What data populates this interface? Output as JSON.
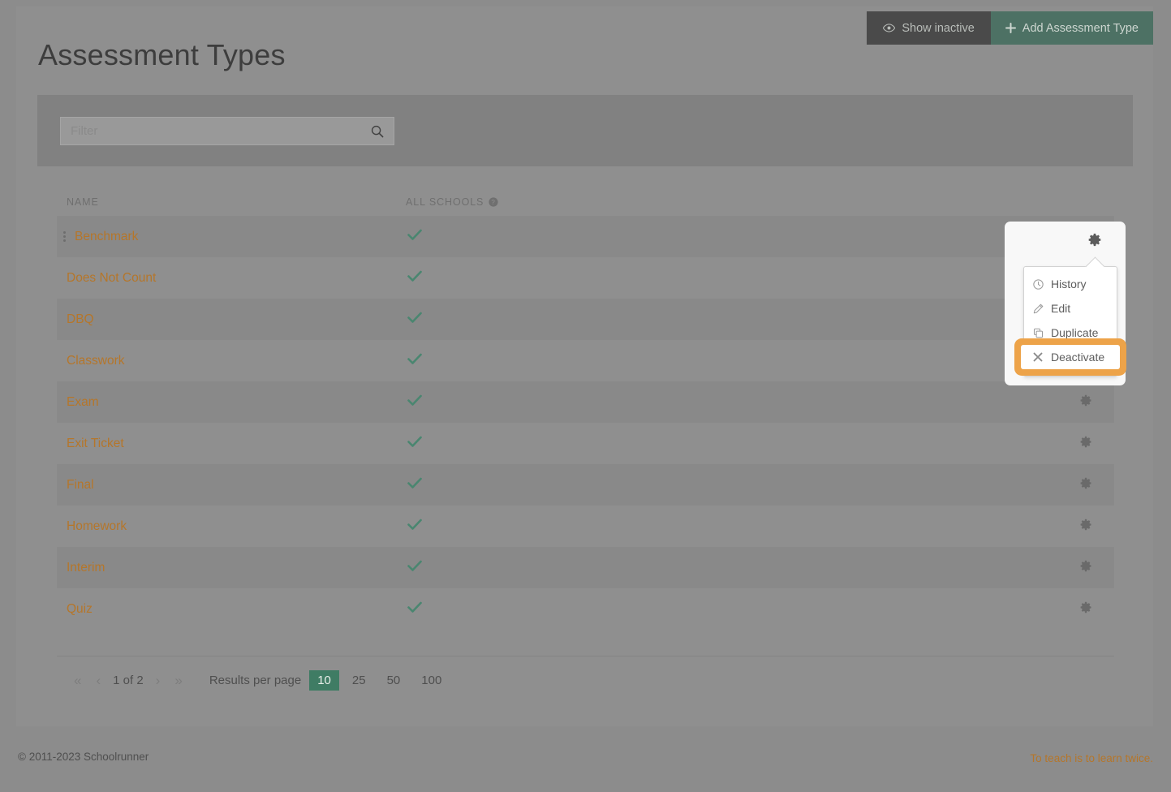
{
  "header": {
    "title": "Assessment Types",
    "actions": [
      {
        "label": "Show inactive",
        "icon": "eye-icon"
      },
      {
        "label": "Add Assessment Type",
        "icon": "plus-icon"
      }
    ]
  },
  "filter": {
    "placeholder": "Filter",
    "value": "",
    "search_icon": "search-icon"
  },
  "table": {
    "columns": [
      {
        "key": "name",
        "label": "NAME"
      },
      {
        "key": "all_schools",
        "label": "ALL SCHOOLS",
        "help_icon": "question-circle-icon"
      }
    ],
    "rows": [
      {
        "name": "Benchmark",
        "all_schools": true,
        "has_drag_handle": true,
        "gear": "gear-icon"
      },
      {
        "name": "Does Not Count",
        "all_schools": true,
        "has_drag_handle": false,
        "gear": "gear-icon"
      },
      {
        "name": "DBQ",
        "all_schools": true,
        "has_drag_handle": false,
        "gear": "gear-icon"
      },
      {
        "name": "Classwork",
        "all_schools": true,
        "has_drag_handle": false,
        "gear": "gear-icon"
      },
      {
        "name": "Exam",
        "all_schools": true,
        "has_drag_handle": false,
        "gear": "gear-icon"
      },
      {
        "name": "Exit Ticket",
        "all_schools": true,
        "has_drag_handle": false,
        "gear": "gear-icon"
      },
      {
        "name": "Final",
        "all_schools": true,
        "has_drag_handle": false,
        "gear": "gear-icon"
      },
      {
        "name": "Homework",
        "all_schools": true,
        "has_drag_handle": false,
        "gear": "gear-icon"
      },
      {
        "name": "Interim",
        "all_schools": true,
        "has_drag_handle": false,
        "gear": "gear-icon"
      },
      {
        "name": "Quiz",
        "all_schools": true,
        "has_drag_handle": false,
        "gear": "gear-icon"
      }
    ]
  },
  "pagination": {
    "first_icon": "«",
    "prev_icon": "‹",
    "page_label": "1 of 2",
    "next_icon": "›",
    "last_icon": "»",
    "results_per_page_label": "Results per page",
    "options": [
      "10",
      "25",
      "50",
      "100"
    ],
    "selected": "10"
  },
  "context_menu": {
    "trigger_icon": "gear-icon",
    "items": [
      {
        "label": "History",
        "icon": "clock-icon",
        "highlighted": false
      },
      {
        "label": "Edit",
        "icon": "pencil-icon",
        "highlighted": false
      },
      {
        "label": "Duplicate",
        "icon": "duplicate-icon",
        "highlighted": false
      },
      {
        "label": "Deactivate",
        "icon": "x-icon",
        "highlighted": true
      }
    ]
  },
  "footer": {
    "copyright": "© 2011-2023 Schoolrunner",
    "tagline": "To teach is to learn twice."
  },
  "colors": {
    "accent_orange": "#b5762a",
    "highlight_orange": "#eda349",
    "green_check": "#4a8670",
    "green_button": "#4d7164",
    "dark_button": "#4a4a4a"
  }
}
